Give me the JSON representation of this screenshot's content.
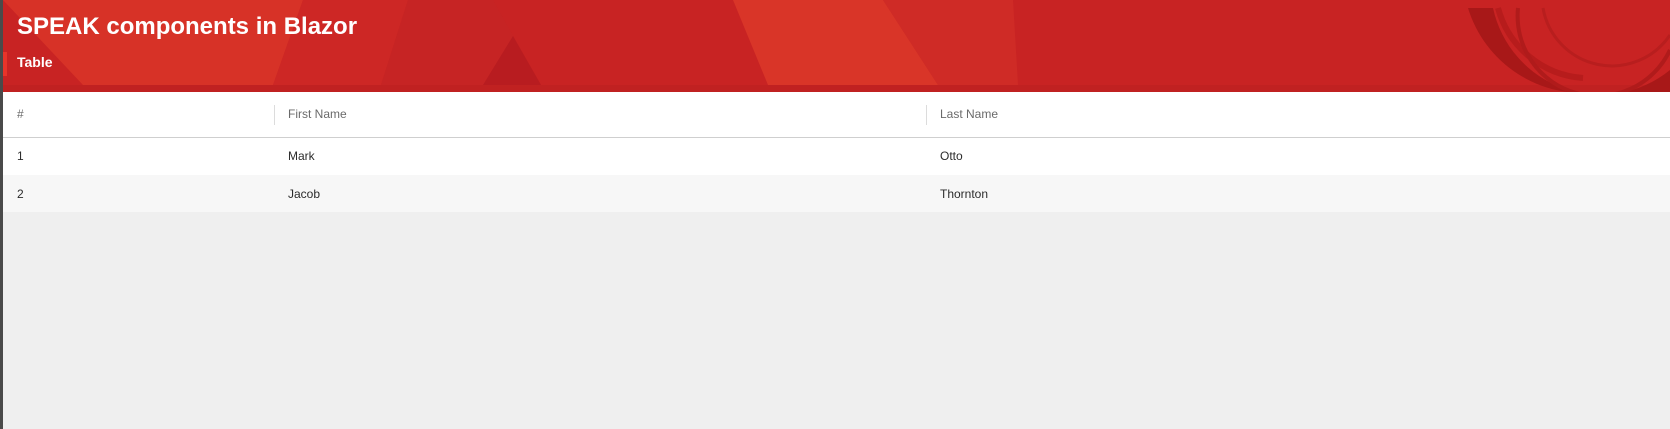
{
  "header": {
    "title": "SPEAK components in Blazor",
    "subtitle": "Table"
  },
  "colors": {
    "header_red": "#c82323",
    "accent_red": "#e8342a",
    "page_background": "#efefef"
  },
  "table": {
    "columns": [
      "#",
      "First Name",
      "Last Name"
    ],
    "rows": [
      [
        "1",
        "Mark",
        "Otto"
      ],
      [
        "2",
        "Jacob",
        "Thornton"
      ]
    ]
  }
}
